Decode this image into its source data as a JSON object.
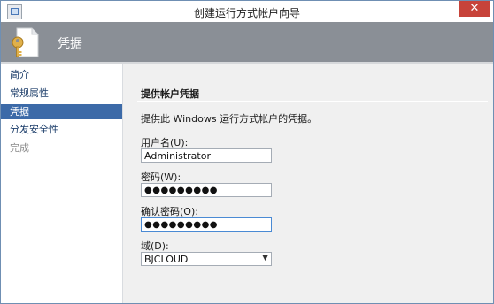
{
  "window": {
    "title": "创建运行方式帐户向导",
    "close_symbol": "✕"
  },
  "header": {
    "title": "凭据",
    "icon": "credential-key-icon"
  },
  "sidebar": {
    "items": [
      {
        "label": "简介",
        "state": "normal"
      },
      {
        "label": "常规属性",
        "state": "normal"
      },
      {
        "label": "凭据",
        "state": "active"
      },
      {
        "label": "分发安全性",
        "state": "normal"
      },
      {
        "label": "完成",
        "state": "disabled"
      }
    ]
  },
  "main": {
    "section_title": "提供帐户凭据",
    "description": "提供此 Windows 运行方式帐户的凭据。",
    "username": {
      "label": "用户名(U):",
      "value": "Administrator"
    },
    "password": {
      "label": "密码(W):",
      "value": "●●●●●●●●●"
    },
    "confirm_password": {
      "label": "确认密码(O):",
      "value": "●●●●●●●●●"
    },
    "domain": {
      "label": "域(D):",
      "value": "BJCLOUD"
    }
  },
  "colors": {
    "header_bg": "#8a8f96",
    "active_nav": "#3c6aa8",
    "close_button": "#c7433a"
  }
}
